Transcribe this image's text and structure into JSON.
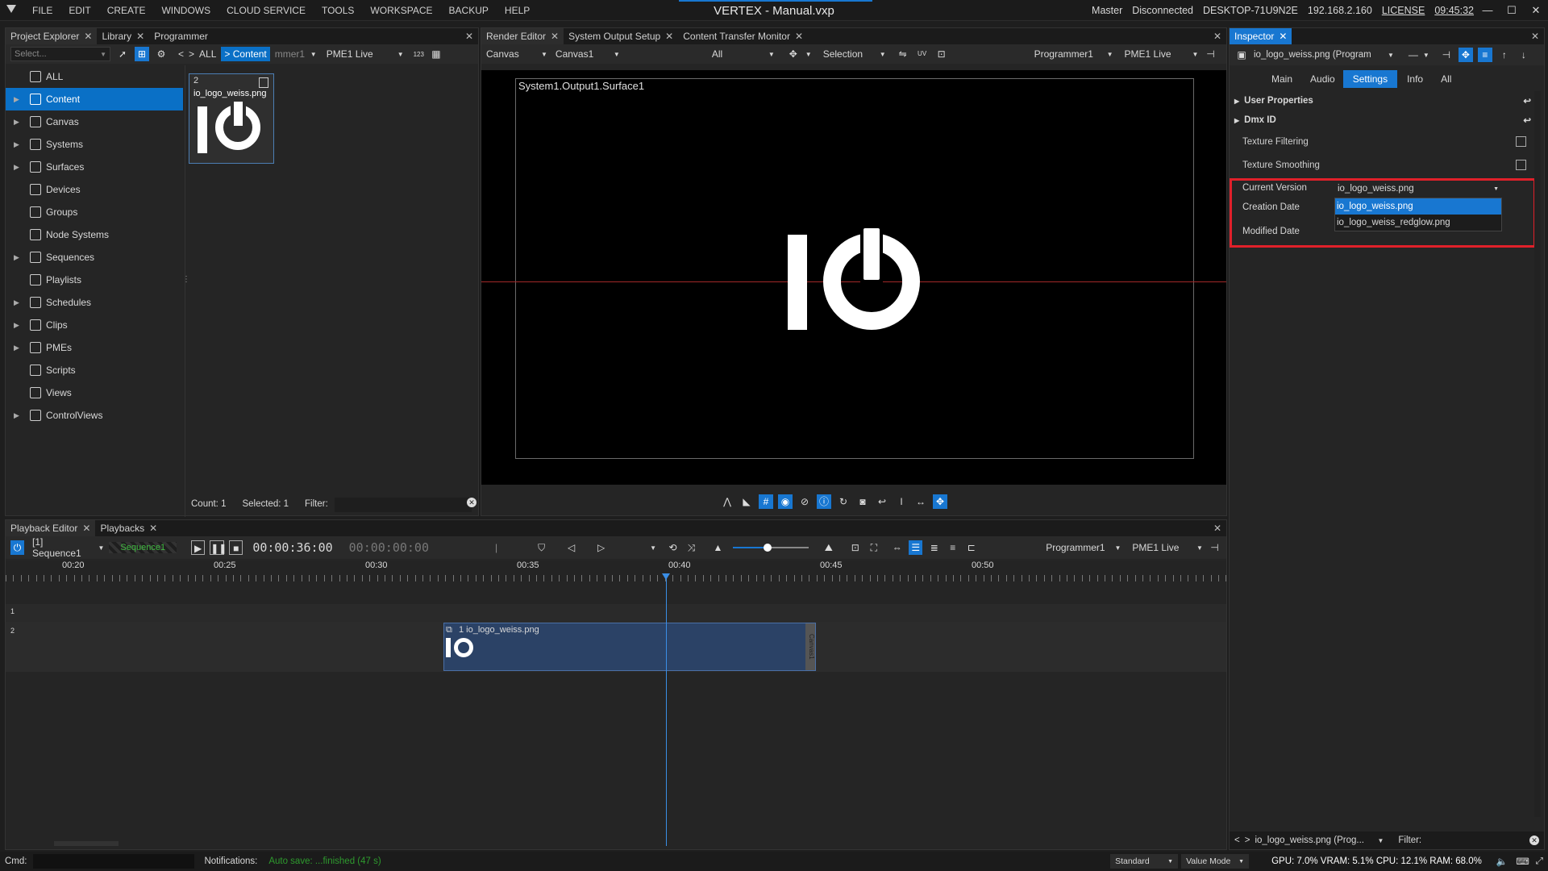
{
  "app": {
    "title": "VERTEX - Manual.vxp",
    "menu": [
      "FILE",
      "EDIT",
      "CREATE",
      "WINDOWS",
      "CLOUD SERVICE",
      "TOOLS",
      "WORKSPACE",
      "BACKUP",
      "HELP"
    ],
    "status_right": {
      "master": "Master",
      "connection": "Disconnected",
      "host": "DESKTOP-71U9N2E",
      "ip": "192.168.2.160",
      "license": "LICENSE",
      "time": "09:45:32"
    }
  },
  "left_panel": {
    "tabs": [
      "Project Explorer",
      "Library",
      "Programmer"
    ],
    "search_placeholder": "Select...",
    "breadcrumb": [
      "<",
      ">",
      "ALL",
      "> Content"
    ],
    "programmer_field": "mmer1",
    "pme_field": "PME1 Live",
    "num_toggle": "123",
    "tree": [
      {
        "label": "ALL",
        "has_arrow": false,
        "selected": false
      },
      {
        "label": "Content",
        "has_arrow": true,
        "selected": true
      },
      {
        "label": "Canvas",
        "has_arrow": true,
        "selected": false
      },
      {
        "label": "Systems",
        "has_arrow": true,
        "selected": false
      },
      {
        "label": "Surfaces",
        "has_arrow": true,
        "selected": false
      },
      {
        "label": "Devices",
        "has_arrow": false,
        "selected": false
      },
      {
        "label": "Groups",
        "has_arrow": false,
        "selected": false
      },
      {
        "label": "Node Systems",
        "has_arrow": false,
        "selected": false
      },
      {
        "label": "Sequences",
        "has_arrow": true,
        "selected": false
      },
      {
        "label": "Playlists",
        "has_arrow": false,
        "selected": false
      },
      {
        "label": "Schedules",
        "has_arrow": true,
        "selected": false
      },
      {
        "label": "Clips",
        "has_arrow": true,
        "selected": false
      },
      {
        "label": "PMEs",
        "has_arrow": true,
        "selected": false
      },
      {
        "label": "Scripts",
        "has_arrow": false,
        "selected": false
      },
      {
        "label": "Views",
        "has_arrow": false,
        "selected": false
      },
      {
        "label": "ControlViews",
        "has_arrow": true,
        "selected": false
      }
    ],
    "content_item": {
      "id": "2",
      "name": "io_logo_weiss.png"
    },
    "footer": {
      "count": "Count: 1",
      "selected": "Selected: 1",
      "filter": "Filter:"
    }
  },
  "render_panel": {
    "tabs": [
      "Render Editor",
      "System Output Setup",
      "Content Transfer Monitor"
    ],
    "toolbar": {
      "canvas_label": "Canvas",
      "canvas_value": "Canvas1",
      "filter": "All",
      "selection": "Selection",
      "programmer": "Programmer1",
      "pme": "PME1 Live",
      "uv": "UV"
    },
    "surface_label": "System1.Output1.Surface1",
    "logo_text": "IO"
  },
  "inspector": {
    "tab": "Inspector",
    "object": "io_logo_weiss.png (Program",
    "subtabs": [
      "Main",
      "Audio",
      "Settings",
      "Info",
      "All"
    ],
    "active_subtab": "Settings",
    "sections": [
      "User Properties",
      "Dmx ID"
    ],
    "rows": [
      {
        "label": "Texture Filtering",
        "checked": false
      },
      {
        "label": "Texture Smoothing",
        "checked": false
      }
    ],
    "current_version_label": "Current Version",
    "current_version_value": "io_logo_weiss.png",
    "creation_date_label": "Creation Date",
    "modified_date_label": "Modified Date",
    "dropdown_options": [
      "io_logo_weiss.png",
      "io_logo_weiss_redglow.png"
    ],
    "dropdown_selected": "io_logo_weiss.png",
    "footer_object": "io_logo_weiss.png (Prog...",
    "footer_filter": "Filter:",
    "highlight_color": "#e0202a"
  },
  "playback_panel": {
    "tabs": [
      "Playback Editor",
      "Playbacks"
    ],
    "sequence": "[1] Sequence1",
    "sequence_tag": "Sequence1",
    "timecode": "00:00:36:00",
    "timecode2": "00:00:00:00",
    "programmer": "Programmer1",
    "pme": "PME1 Live",
    "zoom_level": 0.46,
    "ruler": [
      "00:20",
      "00:25",
      "00:30",
      "00:35",
      "00:40",
      "00:45",
      "00:50"
    ],
    "tracks": [
      "1",
      "2"
    ],
    "clip": {
      "label": "1 io_logo_weiss.png",
      "canvas": "Canvas1",
      "logo": "IO"
    }
  },
  "statusbar": {
    "cmd": "Cmd:",
    "notifications": "Notifications:",
    "notice": "Auto save: ...finished (47 s)",
    "mode": "Standard",
    "value_mode": "Value Mode",
    "stats": "GPU: 7.0%  VRAM: 5.1%  CPU: 12.1%  RAM: 68.0%"
  }
}
